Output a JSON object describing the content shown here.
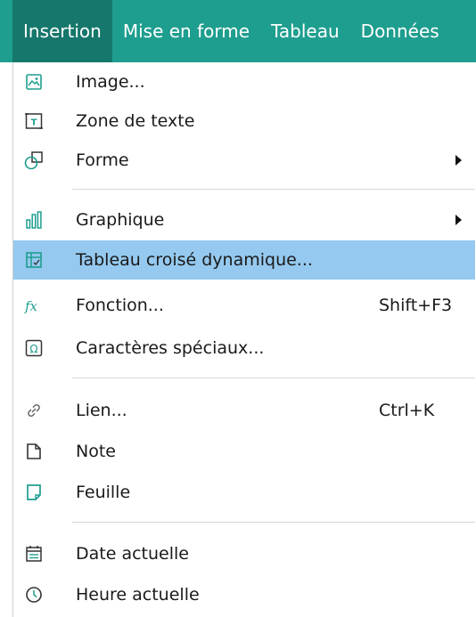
{
  "menubar": {
    "tabs": [
      {
        "label": "Insertion",
        "active": true
      },
      {
        "label": "Mise en forme",
        "active": false
      },
      {
        "label": "Tableau",
        "active": false
      },
      {
        "label": "Données",
        "active": false
      }
    ]
  },
  "menu": {
    "items": [
      {
        "label": "Image...",
        "icon": "image-icon"
      },
      {
        "label": "Zone de texte",
        "icon": "text-box-icon"
      },
      {
        "label": "Forme",
        "icon": "shape-icon",
        "submenu": true
      },
      {
        "label": "Graphique",
        "icon": "chart-icon",
        "submenu": true
      },
      {
        "label": "Tableau croisé dynamique...",
        "icon": "pivot-table-icon",
        "highlighted": true
      },
      {
        "label": "Fonction...",
        "icon": "function-icon",
        "shortcut": "Shift+F3"
      },
      {
        "label": "Caractères spéciaux...",
        "icon": "omega-icon"
      },
      {
        "label": "Lien...",
        "icon": "link-icon",
        "shortcut": "Ctrl+K"
      },
      {
        "label": "Note",
        "icon": "note-icon"
      },
      {
        "label": "Feuille",
        "icon": "sheet-icon"
      },
      {
        "label": "Date actuelle",
        "icon": "calendar-icon"
      },
      {
        "label": "Heure actuelle",
        "icon": "clock-icon"
      }
    ]
  },
  "colors": {
    "menubar_bg": "#1e9e8f",
    "active_tab_bg": "#16776c",
    "highlight_bg": "#95c9ef",
    "icon_color": "#1e9e8f"
  }
}
